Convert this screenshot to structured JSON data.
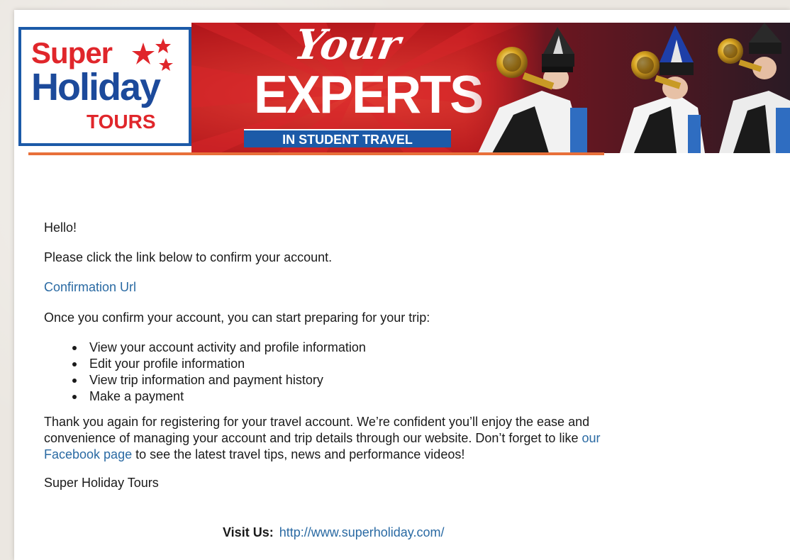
{
  "banner": {
    "logo": {
      "line1": "Super",
      "line2": "Holiday",
      "line3": "TOURS"
    },
    "hero": {
      "script_word": "Your",
      "headline": "EXPERTS",
      "tagline": "IN STUDENT TRAVEL"
    },
    "photo_alt": "marching-band-trumpet-players",
    "colors": {
      "brand_red": "#c8141b",
      "brand_blue": "#1c5aa8",
      "accent_orange": "#e8703a",
      "link_blue": "#2a6aa3"
    }
  },
  "email": {
    "greeting": "Hello!",
    "intro": "Please click the link below to confirm your account.",
    "confirm_link": "Confirmation Url",
    "once_text": "Once you confirm your account, you can start preparing for your trip:",
    "features": [
      "View your account activity and profile information",
      "Edit your profile information",
      "View trip information and payment history",
      "Make a payment"
    ],
    "thanks_before": "Thank you again for registering for your travel account. We’re confident you’ll enjoy the ease and convenience of managing your account and trip details through our website. Don’t forget to like ",
    "facebook_link": "our Facebook page",
    "thanks_after": " to see the latest travel tips, news and performance videos!",
    "signature": "Super Holiday Tours",
    "visit_label": "Visit Us:",
    "visit_url": "http://www.superholiday.com/"
  }
}
